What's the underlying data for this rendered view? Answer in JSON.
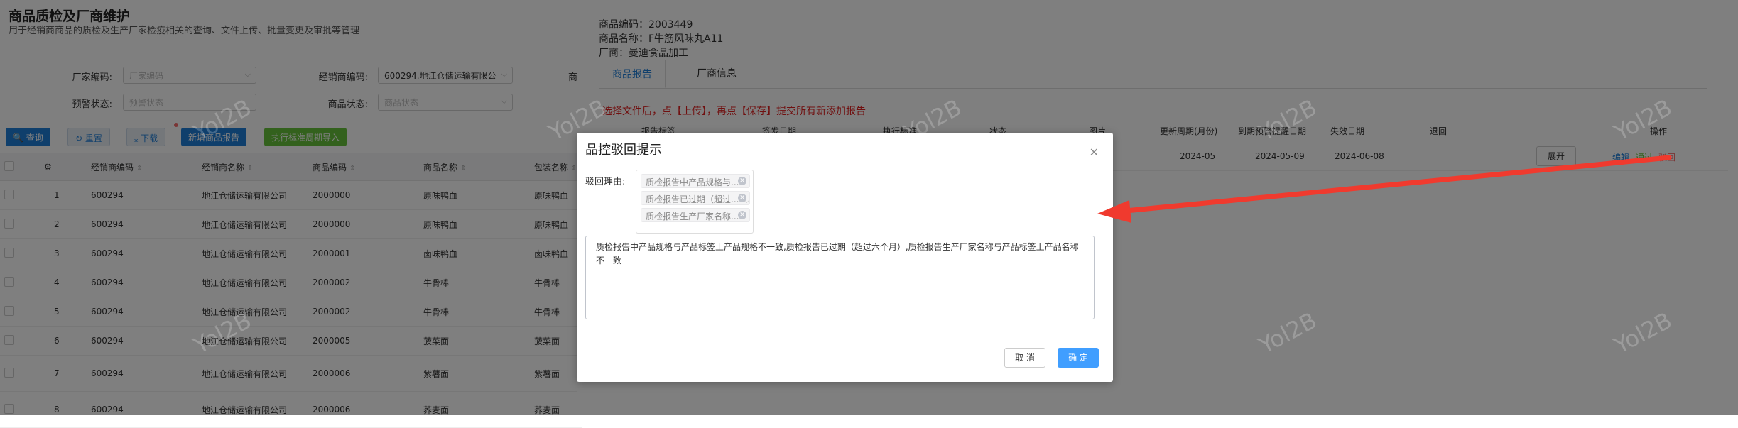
{
  "page": {
    "title": "商品质检及厂商维护",
    "subtitle": "用于经销商商品的质检及生产厂家检疫相关的查询、文件上传、批量变更及审批等管理"
  },
  "filters": {
    "vendor_code_label": "厂家编码:",
    "vendor_code_placeholder": "厂家编码",
    "dealer_code_label": "经销商编码:",
    "dealer_code_value": "600294.地江仓储运输有限公",
    "third_label": "商",
    "warning_label": "预警状态:",
    "warning_placeholder": "预警状态",
    "product_status_label": "商品状态:",
    "product_status_placeholder": "商品状态"
  },
  "toolbar": {
    "query": "查询",
    "reset": "重置",
    "download": "下载",
    "add_report": "新增商品报告",
    "import": "执行标准周期导入"
  },
  "table": {
    "headers": [
      "经销商编码",
      "经销商名称",
      "商品编码",
      "商品名称",
      "包装名称"
    ],
    "rows": [
      {
        "no": "1",
        "dealer_code": "600294",
        "dealer_name": "地江仓储运输有限公司",
        "code": "2000000",
        "name": "原味鸭血",
        "pack": "原味鸭血"
      },
      {
        "no": "2",
        "dealer_code": "600294",
        "dealer_name": "地江仓储运输有限公司",
        "code": "2000000",
        "name": "原味鸭血",
        "pack": "原味鸭血"
      },
      {
        "no": "3",
        "dealer_code": "600294",
        "dealer_name": "地江仓储运输有限公司",
        "code": "2000001",
        "name": "卤味鸭血",
        "pack": "卤味鸭血"
      },
      {
        "no": "4",
        "dealer_code": "600294",
        "dealer_name": "地江仓储运输有限公司",
        "code": "2000002",
        "name": "牛骨棒",
        "pack": "牛骨棒"
      },
      {
        "no": "5",
        "dealer_code": "600294",
        "dealer_name": "地江仓储运输有限公司",
        "code": "2000002",
        "name": "牛骨棒",
        "pack": "牛骨棒"
      },
      {
        "no": "6",
        "dealer_code": "600294",
        "dealer_name": "地江仓储运输有限公司",
        "code": "2000005",
        "name": "菠菜面",
        "pack": "菠菜面"
      },
      {
        "no": "7",
        "dealer_code": "600294",
        "dealer_name": "地江仓储运输有限公司",
        "code": "2000006",
        "name": "紫薯面",
        "pack": "紫薯面"
      },
      {
        "no": "8",
        "dealer_code": "600294",
        "dealer_name": "地江仓储运输有限公司",
        "code": "2000006",
        "name": "荞麦面",
        "pack": "荞麦面"
      }
    ]
  },
  "drawer": {
    "code_line": "商品编码：2003449",
    "name_line": "商品名称：F牛筋风味丸A11",
    "vendor_line": "厂商：曼迪食品加工",
    "tab_report": "商品报告",
    "tab_vendor": "厂商信息",
    "notice": "选择文件后，点【上传】，再点【保存】提交所有新添加报告",
    "head": {
      "c1": "报告标签",
      "c2": "签发日期",
      "c3": "执行标准",
      "c4": "状态",
      "c5": "图片",
      "c6": "更新周期(月份)",
      "c7": "到期预警提醒日期",
      "c8": "失效日期",
      "c9": "退回",
      "c10": "操作"
    },
    "row": {
      "period": "2024-05",
      "warn_date": "2024-05-09",
      "expire_date": "2024-06-08",
      "expand": "展开",
      "edit": "编辑",
      "pass": "通过",
      "reject": "驳回"
    }
  },
  "watermark": "Yol2B",
  "modal": {
    "title": "品控驳回提示",
    "reason_label": "驳回理由:",
    "tags": [
      "质检报告中产品规格与...",
      "质检报告已过期（超过...",
      "质检报告生产厂家名称..."
    ],
    "reason_text": "质检报告中产品规格与产品标签上产品规格不一致,质检报告已过期（超过六个月）,质检报告生产厂家名称与产品标签上产品名称不一致",
    "cancel": "取 消",
    "confirm": "确 定"
  },
  "colors": {
    "primary": "#1e7fd9",
    "success": "#67c23a",
    "danger": "#f56c6c",
    "annotation": "#f03a2e"
  }
}
